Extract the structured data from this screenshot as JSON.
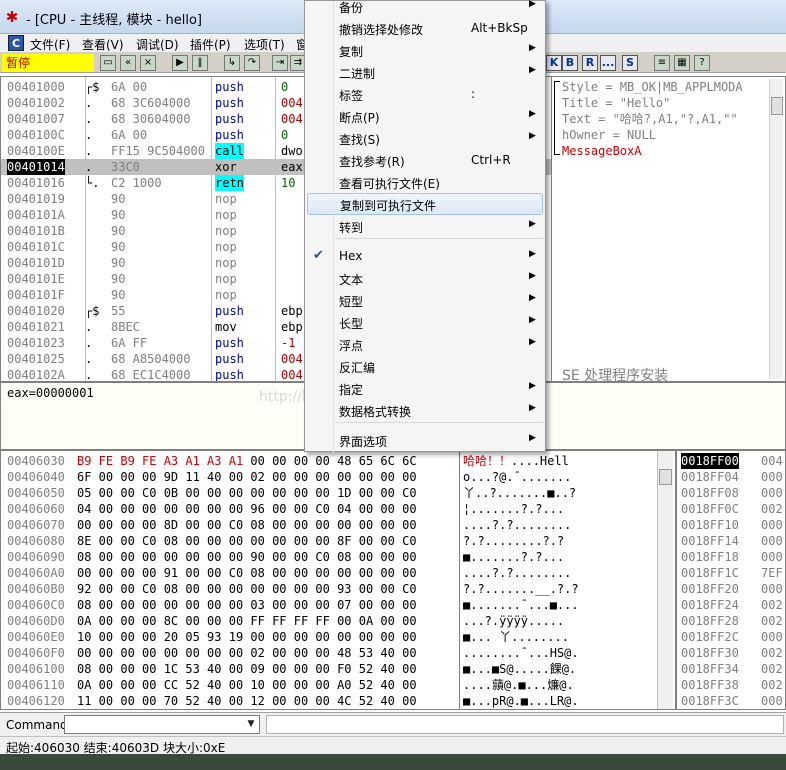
{
  "window": {
    "title": "- [CPU - 主线程, 模块 - hello]",
    "app_icon": "bug-icon"
  },
  "menubar": {
    "items": [
      "文件(F)",
      "查看(V)",
      "调试(D)",
      "插件(P)",
      "选项(T)",
      "窗"
    ]
  },
  "toolbar": {
    "status": "暂停",
    "letter_buttons": [
      "K",
      "B",
      "R",
      "...",
      "S"
    ]
  },
  "disasm": {
    "rows": [
      {
        "addr": "00401000",
        "mark": "┌$",
        "bytes": "6A 00",
        "mn": "push",
        "op": "0"
      },
      {
        "addr": "00401002",
        "mark": ".",
        "bytes": "68 3C604000",
        "mn": "push",
        "op": "004"
      },
      {
        "addr": "00401007",
        "mark": ".",
        "bytes": "68 30604000",
        "mn": "push",
        "op": "004"
      },
      {
        "addr": "0040100C",
        "mark": ".",
        "bytes": "6A 00",
        "mn": "push",
        "op": "0"
      },
      {
        "addr": "0040100E",
        "mark": ".",
        "bytes": "FF15 9C504000",
        "mn": "call",
        "op": "dwo"
      },
      {
        "addr": "00401014",
        "mark": ".",
        "bytes": "33C0",
        "mn": "xor",
        "op": "eax"
      },
      {
        "addr": "00401016",
        "mark": "└.",
        "bytes": "C2 1000",
        "mn": "retn",
        "op": "10"
      },
      {
        "addr": "00401019",
        "mark": "",
        "bytes": "90",
        "mn": "nop",
        "op": ""
      },
      {
        "addr": "0040101A",
        "mark": "",
        "bytes": "90",
        "mn": "nop",
        "op": ""
      },
      {
        "addr": "0040101B",
        "mark": "",
        "bytes": "90",
        "mn": "nop",
        "op": ""
      },
      {
        "addr": "0040101C",
        "mark": "",
        "bytes": "90",
        "mn": "nop",
        "op": ""
      },
      {
        "addr": "0040101D",
        "mark": "",
        "bytes": "90",
        "mn": "nop",
        "op": ""
      },
      {
        "addr": "0040101E",
        "mark": "",
        "bytes": "90",
        "mn": "nop",
        "op": ""
      },
      {
        "addr": "0040101F",
        "mark": "",
        "bytes": "90",
        "mn": "nop",
        "op": ""
      },
      {
        "addr": "00401020",
        "mark": "┌$",
        "bytes": "55",
        "mn": "push",
        "op": "ebp"
      },
      {
        "addr": "00401021",
        "mark": ".",
        "bytes": "8BEC",
        "mn": "mov",
        "op": "ebp"
      },
      {
        "addr": "00401023",
        "mark": ".",
        "bytes": "6A FF",
        "mn": "push",
        "op": "-1"
      },
      {
        "addr": "00401025",
        "mark": ".",
        "bytes": "68 A8504000",
        "mn": "push",
        "op": "004"
      },
      {
        "addr": "0040102A",
        "mark": ".",
        "bytes": "68 EC1C4000",
        "mn": "push",
        "op": "004"
      }
    ],
    "selected_addr": "00401014"
  },
  "comments": {
    "lines": [
      "Style = MB_OK|MB_APPLMODA",
      "Title = \"Hello\"",
      "Text = \"哈哈?,A1,\"?,A1,\"\"",
      "hOwner = NULL",
      "MessageBoxA"
    ],
    "seh_note": "SE 处理程序安装"
  },
  "info": {
    "text": "eax=00000001",
    "watermark": "http://blog.csdn.net/billvsme"
  },
  "dump": {
    "rows": [
      {
        "addr": "00406030",
        "hex": "B9 FE B9 FE A3 A1 A3 A1 00 00 00 00 48 65 6C 6C",
        "asc": "哈哈！！....Hell"
      },
      {
        "addr": "00406040",
        "hex": "6F 00 00 00 9D 11 40 00 02 00 00 00 00 00 00 00",
        "asc": "o...?@.¯......."
      },
      {
        "addr": "00406050",
        "hex": "05 00 00 C0 0B 00 00 00 00 00 00 00 1D 00 00 C0",
        "asc": "丫..?.......■..?"
      },
      {
        "addr": "00406060",
        "hex": "04 00 00 00 00 00 00 00 96 00 00 C0 04 00 00 00",
        "asc": "¦.......?.?..."
      },
      {
        "addr": "00406070",
        "hex": "00 00 00 00 8D 00 00 C0 08 00 00 00 00 00 00 00",
        "asc": "....?.?........"
      },
      {
        "addr": "00406080",
        "hex": "8E 00 00 C0 08 00 00 00 00 00 00 00 8F 00 00 C0",
        "asc": "?.?........?.?"
      },
      {
        "addr": "00406090",
        "hex": "08 00 00 00 00 00 00 00 90 00 00 C0 08 00 00 00",
        "asc": "■.......?.?..."
      },
      {
        "addr": "004060A0",
        "hex": "00 00 00 00 91 00 00 C0 08 00 00 00 00 00 00 00",
        "asc": "....?.?........"
      },
      {
        "addr": "004060B0",
        "hex": "92 00 00 C0 08 00 00 00 00 00 00 00 93 00 00 C0",
        "asc": "?.?.......__.?.?"
      },
      {
        "addr": "004060C0",
        "hex": "08 00 00 00 00 00 00 00 03 00 00 00 07 00 00 00",
        "asc": "■.......¯...■..."
      },
      {
        "addr": "004060D0",
        "hex": "0A 00 00 00 8C 00 00 00 FF FF FF FF 00 0A 00 00",
        "asc": "...?.ÿÿÿÿ.....   "
      },
      {
        "addr": "004060E0",
        "hex": "10 00 00 00 20 05 93 19 00 00 00 00 00 00 00 00",
        "asc": "■... 丫........"
      },
      {
        "addr": "004060F0",
        "hex": "00 00 00 00 00 00 00 00 02 00 00 00 48 53 40 00",
        "asc": "........¯...HS@."
      },
      {
        "addr": "00406100",
        "hex": "08 00 00 00 1C 53 40 00 09 00 00 00 F0 52 40 00",
        "asc": "■...■S@.....餜@."
      },
      {
        "addr": "00406110",
        "hex": "0A 00 00 00 CC 52 40 00 10 00 00 00 A0 52 40 00",
        "asc": "....蘏@.■...燫@."
      },
      {
        "addr": "00406120",
        "hex": "11 00 00 00 70 52 40 00 12 00 00 00 4C 52 40 00",
        "asc": "■...pR@.■...LR@."
      }
    ]
  },
  "stack": {
    "rows": [
      {
        "addr": "0018FF00",
        "val": "004"
      },
      {
        "addr": "0018FF04",
        "val": "000"
      },
      {
        "addr": "0018FF08",
        "val": "000"
      },
      {
        "addr": "0018FF0C",
        "val": "002"
      },
      {
        "addr": "0018FF10",
        "val": "000"
      },
      {
        "addr": "0018FF14",
        "val": "000"
      },
      {
        "addr": "0018FF18",
        "val": "000"
      },
      {
        "addr": "0018FF1C",
        "val": "7EF"
      },
      {
        "addr": "0018FF20",
        "val": "000"
      },
      {
        "addr": "0018FF24",
        "val": "002"
      },
      {
        "addr": "0018FF28",
        "val": "002"
      },
      {
        "addr": "0018FF2C",
        "val": "000"
      },
      {
        "addr": "0018FF30",
        "val": "002"
      },
      {
        "addr": "0018FF34",
        "val": "002"
      },
      {
        "addr": "0018FF38",
        "val": "002"
      },
      {
        "addr": "0018FF3C",
        "val": "000"
      }
    ]
  },
  "command": {
    "label": "Command",
    "value": ""
  },
  "statusbar": {
    "text": "起始:406030 结束:40603D 块大小:0xE"
  },
  "context_menu": {
    "items": [
      {
        "label": "备份",
        "shortcut": "",
        "submenu": true
      },
      {
        "label": "撤销选择处修改",
        "shortcut": "Alt+BkSp",
        "submenu": false
      },
      {
        "label": "复制",
        "shortcut": "",
        "submenu": true
      },
      {
        "label": "二进制",
        "shortcut": "",
        "submenu": true
      },
      {
        "label": "标签",
        "shortcut": ":",
        "submenu": false
      },
      {
        "label": "断点(P)",
        "shortcut": "",
        "submenu": true
      },
      {
        "label": "查找(S)",
        "shortcut": "",
        "submenu": true
      },
      {
        "label": "查找参考(R)",
        "shortcut": "Ctrl+R",
        "submenu": false
      },
      {
        "label": "查看可执行文件(E)",
        "shortcut": "",
        "submenu": false
      },
      {
        "label": "复制到可执行文件",
        "shortcut": "",
        "submenu": false,
        "highlighted": true
      },
      {
        "label": "转到",
        "shortcut": "",
        "submenu": true
      },
      {
        "label": "Hex",
        "shortcut": "",
        "submenu": true,
        "checked": true
      },
      {
        "label": "文本",
        "shortcut": "",
        "submenu": true
      },
      {
        "label": "短型",
        "shortcut": "",
        "submenu": true
      },
      {
        "label": "长型",
        "shortcut": "",
        "submenu": true
      },
      {
        "label": "浮点",
        "shortcut": "",
        "submenu": true
      },
      {
        "label": "反汇编",
        "shortcut": "",
        "submenu": false
      },
      {
        "label": "指定",
        "shortcut": "",
        "submenu": true
      },
      {
        "label": "数据格式转换",
        "shortcut": "",
        "submenu": true
      },
      {
        "label": "界面选项",
        "shortcut": "",
        "submenu": true
      }
    ]
  }
}
